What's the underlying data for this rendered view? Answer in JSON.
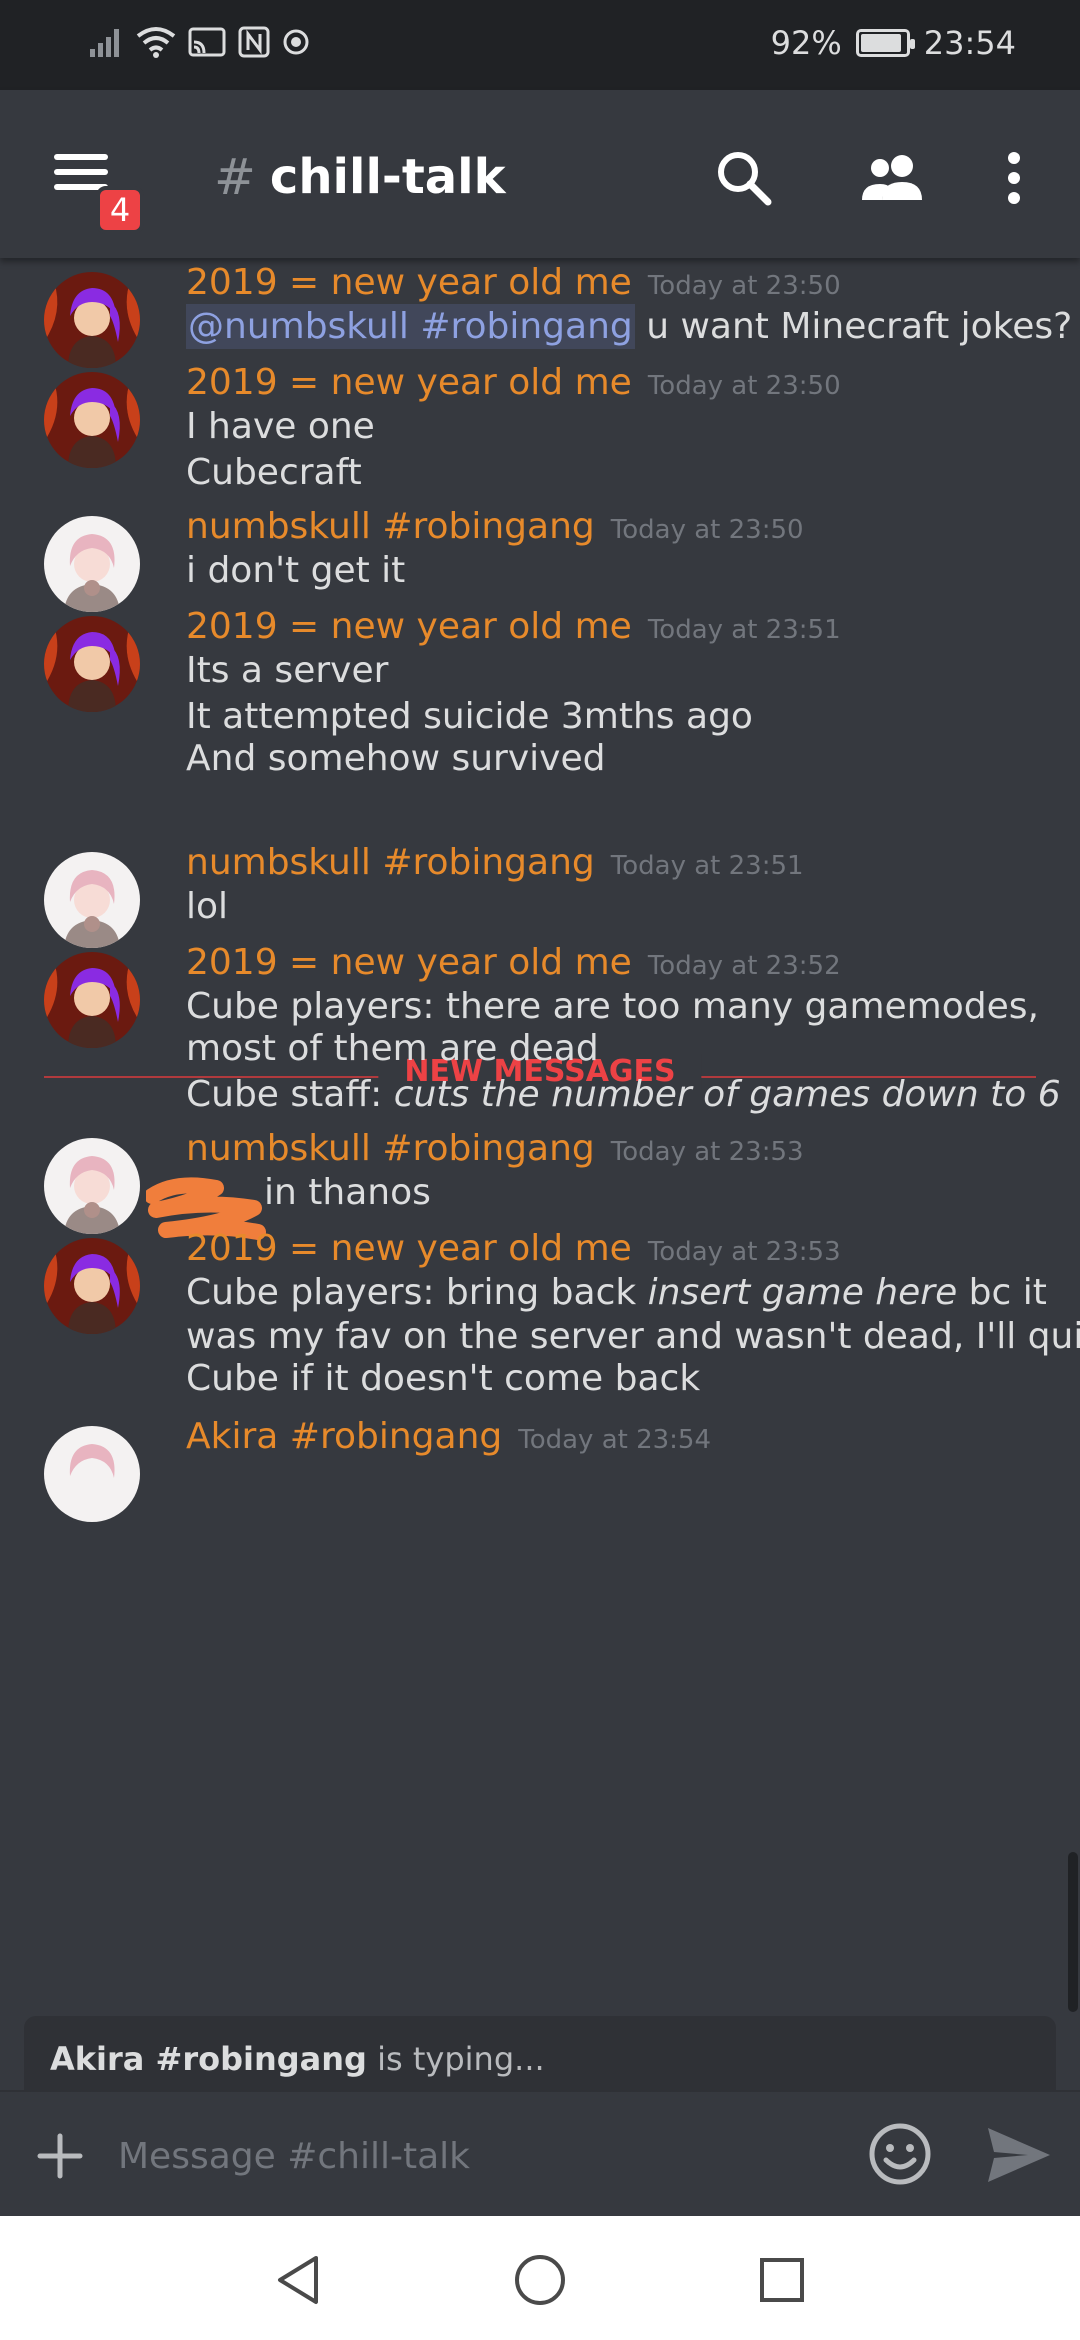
{
  "status_bar": {
    "battery": "92%",
    "battery_level": 0.92,
    "time": "23:54",
    "icons": [
      "signal-icon",
      "wifi-icon",
      "cast-icon",
      "nfc-icon",
      "record-icon"
    ]
  },
  "header": {
    "hash": "#",
    "channel": "chill-talk",
    "badge": "4",
    "icons": [
      "menu-icon",
      "search-icon",
      "members-icon",
      "more-icon"
    ]
  },
  "messages": [
    {
      "author": "2019 = new year old me",
      "time": "Today at 23:50",
      "avatar": "purple-hair",
      "mention": "@numbskull #robingang",
      "lines": [
        " u want Minecraft jokes?"
      ]
    },
    {
      "author": "2019 = new year old me",
      "time": "Today at 23:50",
      "avatar": "purple-hair",
      "lines": [
        "I have one",
        "Cubecraft"
      ]
    },
    {
      "author": "numbskull #robingang",
      "time": "Today at 23:50",
      "avatar": "pink-hair",
      "lines": [
        "i don't get it"
      ]
    },
    {
      "author": "2019 = new year old me",
      "time": "Today at 23:51",
      "avatar": "purple-hair",
      "lines": [
        "Its a server",
        "It attempted suicide 3mths ago",
        "And somehow survived"
      ]
    },
    {
      "author": "numbskull #robingang",
      "time": "Today at 23:51",
      "avatar": "pink-hair",
      "lines": [
        "lol"
      ]
    },
    {
      "author": "2019 = new year old me",
      "time": "Today at 23:52",
      "avatar": "purple-hair",
      "lines": [
        "Cube players: there are too many gamemodes,",
        "most of them are dead"
      ],
      "line3_prefix": "Cube staff: ",
      "line3_italic": "cuts the number of games down to 6"
    },
    {
      "author": "numbskull #robingang",
      "time": "Today at 23:53",
      "avatar": "pink-hair",
      "lines": [
        "in thanos"
      ]
    },
    {
      "author": "2019 = new year old me",
      "time": "Today at 23:53",
      "avatar": "purple-hair",
      "line1_prefix": "Cube players: bring back ",
      "line1_italic": "insert game here",
      "line1_suffix": " bc it",
      "lines": [
        "was my fav on the server and wasn't dead, I'll quit",
        "Cube if it doesn't come back"
      ]
    },
    {
      "author": "Akira #robingang",
      "time": "Today at 23:54",
      "avatar": "pink-hair"
    }
  ],
  "new_messages_label": "NEW MESSAGES",
  "typing": {
    "user": "Akira #robingang",
    "text": " is typing..."
  },
  "composer": {
    "placeholder": "Message #chill-talk",
    "icons": [
      "plus-icon",
      "emoji-icon",
      "send-icon"
    ]
  },
  "nav_bar": {
    "icons": [
      "back-icon",
      "home-icon",
      "recents-icon"
    ]
  },
  "colors": {
    "background": "#36393f",
    "statusbar": "#202225",
    "author": "#e78a2b",
    "timestamp": "#72767d",
    "mention": "#8ea1e1",
    "new_messages": "#ed4245"
  }
}
